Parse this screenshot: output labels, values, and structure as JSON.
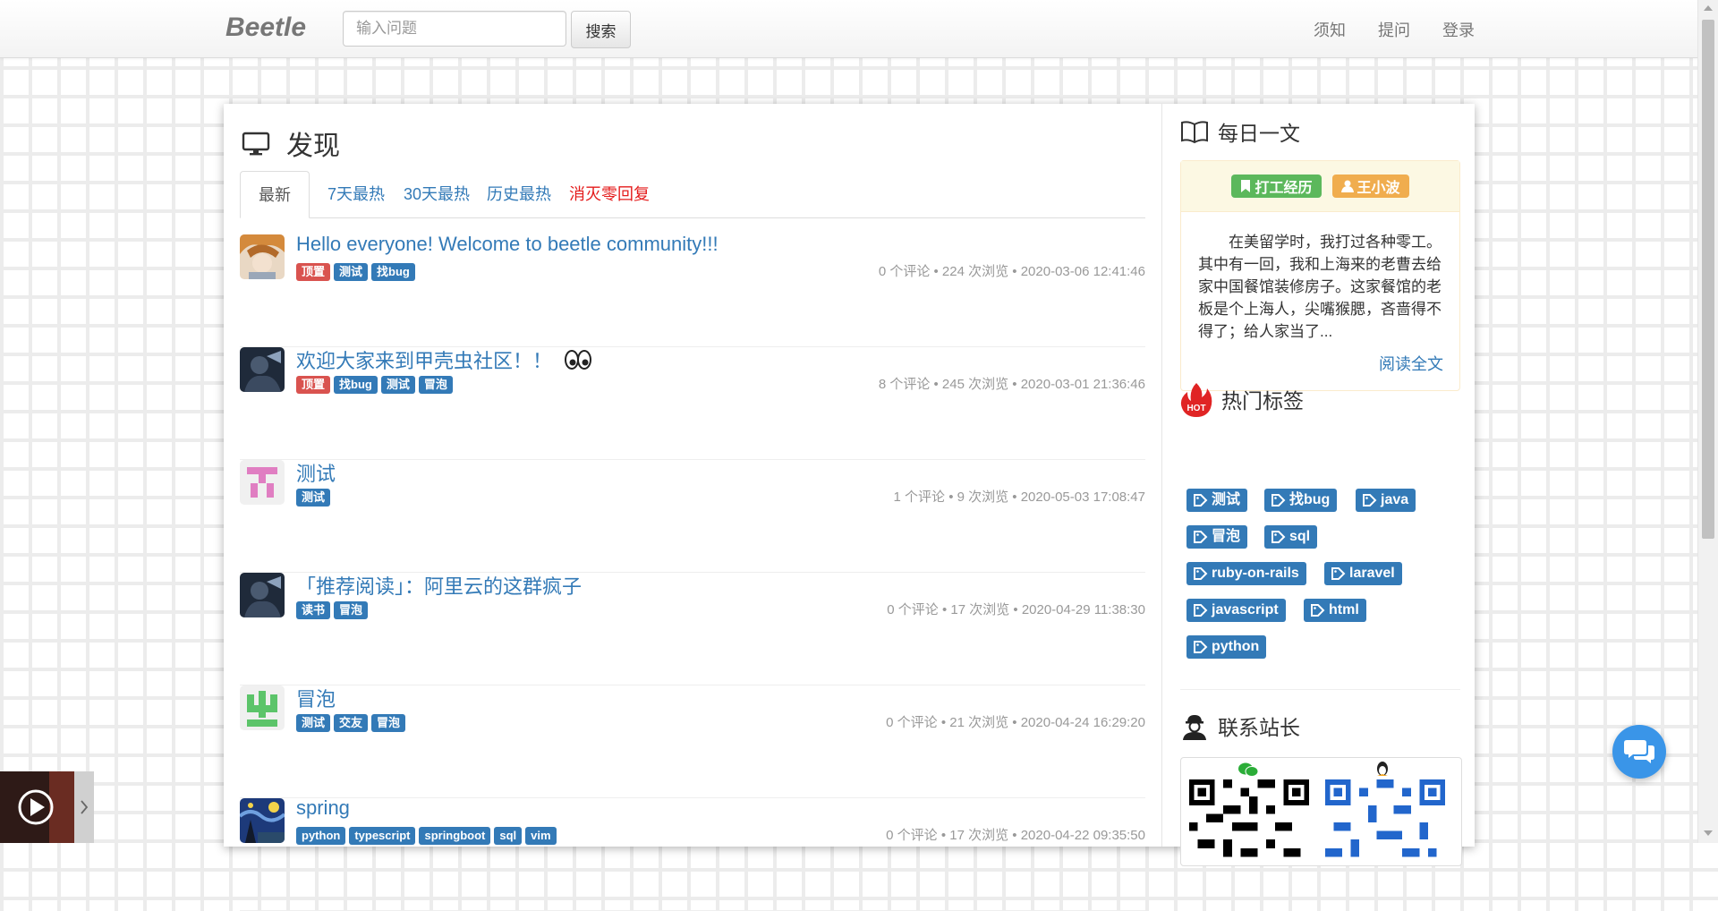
{
  "navbar": {
    "brand": "Beetle",
    "search_placeholder": "输入问题",
    "search_button": "搜索",
    "links": [
      "须知",
      "提问",
      "登录"
    ]
  },
  "main": {
    "title": "发现",
    "tabs": [
      "最新",
      "7天最热",
      "30天最热",
      "历史最热",
      "消灭零回复"
    ],
    "active_tab": "最新",
    "posts": [
      {
        "title": "Hello everyone! Welcome to beetle community!!!",
        "tags": [
          {
            "label": "顶置",
            "color": "red"
          },
          {
            "label": "测试",
            "color": "blue"
          },
          {
            "label": "找bug",
            "color": "blue"
          }
        ],
        "meta": "0 个评论 • 224 次浏览 • 2020-03-06 12:41:46",
        "avatar": "avatar-anime-photo"
      },
      {
        "title": "欢迎大家来到甲壳虫社区！！",
        "title_emoji": "eyes-icon",
        "tags": [
          {
            "label": "顶置",
            "color": "red"
          },
          {
            "label": "找bug",
            "color": "blue"
          },
          {
            "label": "测试",
            "color": "blue"
          },
          {
            "label": "冒泡",
            "color": "blue"
          }
        ],
        "meta": "8 个评论 • 245 次浏览 • 2020-03-01 21:36:46",
        "avatar": "avatar-dark-photo"
      },
      {
        "title": "测试",
        "tags": [
          {
            "label": "测试",
            "color": "blue"
          }
        ],
        "meta": "1 个评论 • 9 次浏览 • 2020-05-03 17:08:47",
        "avatar": "avatar-pink-identicon"
      },
      {
        "title": "「推荐阅读」：阿里云的这群疯子",
        "tags": [
          {
            "label": "读书",
            "color": "blue"
          },
          {
            "label": "冒泡",
            "color": "blue"
          }
        ],
        "meta": "0 个评论 • 17 次浏览 • 2020-04-29 11:38:30",
        "avatar": "avatar-dark-photo"
      },
      {
        "title": "冒泡",
        "tags": [
          {
            "label": "测试",
            "color": "blue"
          },
          {
            "label": "交友",
            "color": "blue"
          },
          {
            "label": "冒泡",
            "color": "blue"
          }
        ],
        "meta": "0 个评论 • 21 次浏览 • 2020-04-24 16:29:20",
        "avatar": "avatar-green-identicon"
      },
      {
        "title": "spring",
        "tags": [
          {
            "label": "python",
            "color": "blue"
          },
          {
            "label": "typescript",
            "color": "blue"
          },
          {
            "label": "springboot",
            "color": "blue"
          },
          {
            "label": "sql",
            "color": "blue"
          },
          {
            "label": "vim",
            "color": "blue"
          }
        ],
        "meta": "0 个评论 • 17 次浏览 • 2020-04-22 09:35:50",
        "avatar": "avatar-starry-night"
      }
    ]
  },
  "sidebar": {
    "daily": {
      "heading": "每日一文",
      "category": "打工经历",
      "author": "王小波",
      "excerpt": "在美留学时，我打过各种零工。其中有一回，我和上海来的老曹去给家中国餐馆装修房子。这家餐馆的老板是个上海人，尖嘴猴腮，吝啬得不得了；给人家当了...",
      "read_more": "阅读全文"
    },
    "hot_tags": {
      "heading": "热门标签",
      "badge": "HOT",
      "tags": [
        "测试",
        "找bug",
        "java",
        "冒泡",
        "sql",
        "ruby-on-rails",
        "laravel",
        "javascript",
        "html",
        "python"
      ]
    },
    "contact": {
      "heading": "联系站长"
    }
  },
  "colors": {
    "link": "#337ab7",
    "tag_blue": "#337ab7",
    "tag_red": "#d9534f",
    "label_green": "#5cb85c",
    "label_orange": "#f0ad4e",
    "warning_bg": "#fcf8e3",
    "alert_red": "#e41b1b",
    "chat_button": "#3a95e8"
  }
}
